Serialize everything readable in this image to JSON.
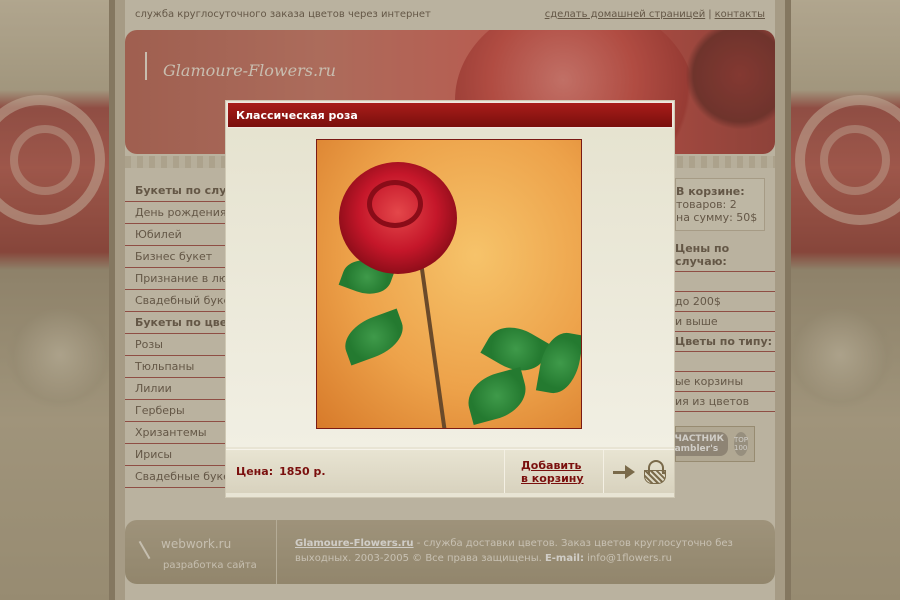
{
  "topbar": {
    "tagline": "служба круглосуточного заказа цветов через интернет",
    "home_link": "сделать домашней страницей",
    "separator": "|",
    "contacts_link": "контакты"
  },
  "header": {
    "logo_text": "Glamoure-Flowers.ru"
  },
  "left_nav": {
    "occasion_head": "Букеты по случаю",
    "occasion_items": [
      "День рождения",
      "Юбилей",
      "Бизнес букет",
      "Признание в любви",
      "Свадебный букет"
    ],
    "color_head": "Букеты по цвету",
    "color_items": [
      "Розы",
      "Тюльпаны",
      "Лилии",
      "Герберы",
      "Хризантемы",
      "Ирисы",
      "Свадебные букеты"
    ]
  },
  "right_panel": {
    "cart_title": "В корзине:",
    "cart_items": "товаров: 2",
    "cart_sum": "на сумму: 50$",
    "price_head": "Цены по случаю:",
    "price_items": [
      "",
      "до 200$",
      "и выше"
    ],
    "type_head": "Цветы по типу:",
    "type_items": [
      "",
      "ые корзины",
      "ия из цветов"
    ],
    "rambler_badge": "УЧАСТНИК Rambler's",
    "rambler_top": "TOP 100"
  },
  "footer": {
    "dev_line1": "webwork.ru",
    "dev_line2": "разработка сайта",
    "site_name": "Glamoure-Flowers.ru",
    "description": " - служба доставки цветов. Заказ цветов круглосуточно без выходных. 2003-2005 © Все права защищены.",
    "email_label": "E-mail:",
    "email": "info@1flowers.ru"
  },
  "modal": {
    "title": "Классическая роза",
    "price_label": "Цена:",
    "price_value": "1850 р.",
    "add_line1": "Добавить",
    "add_line2": "в корзину",
    "icons": [
      "arrow-right-icon",
      "basket-icon"
    ]
  },
  "colors": {
    "accent": "#7a0f0d",
    "title_bar": "#a81d1a",
    "page_bg": "#ddd6c2"
  }
}
